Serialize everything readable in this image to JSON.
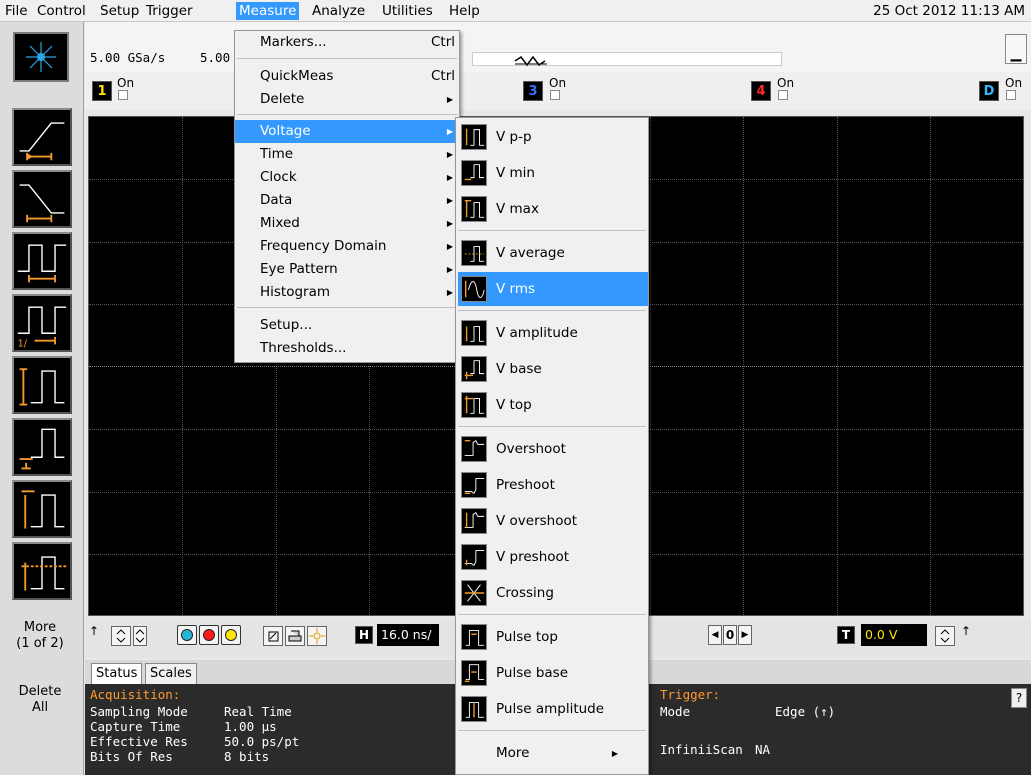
{
  "menubar": {
    "items": [
      "File",
      "Control",
      "Setup",
      "Trigger",
      "Measure",
      "Analyze",
      "Utilities",
      "Help"
    ],
    "active": "Measure",
    "datetime": "25 Oct 2012 11:13 AM"
  },
  "sidebar": {
    "more_label_1": "More",
    "more_label_2": "(1 of 2)",
    "delete_label_1": "Delete",
    "delete_label_2": "All"
  },
  "top": {
    "sample_rate": "5.00 GSa/s",
    "sample_pts": "5.00"
  },
  "channels": [
    {
      "num": "1",
      "state": "On",
      "color": "#ffe600"
    },
    {
      "num": "3",
      "state": "On",
      "color": "#3b6dff"
    },
    {
      "num": "4",
      "state": "On",
      "color": "#ff2a2a"
    },
    {
      "num": "D",
      "state": "On",
      "color": "#35b8ff"
    }
  ],
  "controls": {
    "timebase": "16.0 ns/",
    "trigger_level": "0.0 V",
    "offset_value": "0",
    "run_colors": [
      "#29b6d6",
      "#ff1a1a",
      "#ffe600"
    ]
  },
  "status": {
    "tabs": [
      "Status",
      "Scales"
    ],
    "acq_title": "Acquisition:",
    "sampling_mode_label": "Sampling Mode",
    "sampling_mode_value": "Real Time",
    "capture_time_label": "Capture Time",
    "capture_time_value": "1.00 µs",
    "eff_res_label": "Effective Res",
    "eff_res_value": "50.0 ps/pt",
    "bits_label": "Bits Of Res",
    "bits_value": "8 bits",
    "trig_title": "Trigger:",
    "mode_label": "Mode",
    "mode_value": "Edge (↑)",
    "infiniiscan_label": "InfiniiScan",
    "infiniiscan_value": "NA",
    "help": "?"
  },
  "measure_menu": {
    "markers": "Markers...",
    "markers_sc": "Ctrl",
    "quickmeas": "QuickMeas",
    "quickmeas_sc": "Ctrl",
    "delete": "Delete",
    "voltage": "Voltage",
    "time": "Time",
    "clock": "Clock",
    "data": "Data",
    "mixed": "Mixed",
    "freq": "Frequency Domain",
    "eye": "Eye Pattern",
    "histogram": "Histogram",
    "setup": "Setup...",
    "thresholds": "Thresholds..."
  },
  "voltage_menu": {
    "items": [
      "V p-p",
      "V min",
      "V max",
      "V average",
      "V rms",
      "V amplitude",
      "V base",
      "V top",
      "Overshoot",
      "Preshoot",
      "V overshoot",
      "V preshoot",
      "Crossing",
      "Pulse top",
      "Pulse base",
      "Pulse amplitude"
    ],
    "highlighted": "V rms",
    "more": "More"
  },
  "colors": {
    "accent": "#3399ff",
    "measure_orange": "#ff9a2e"
  }
}
